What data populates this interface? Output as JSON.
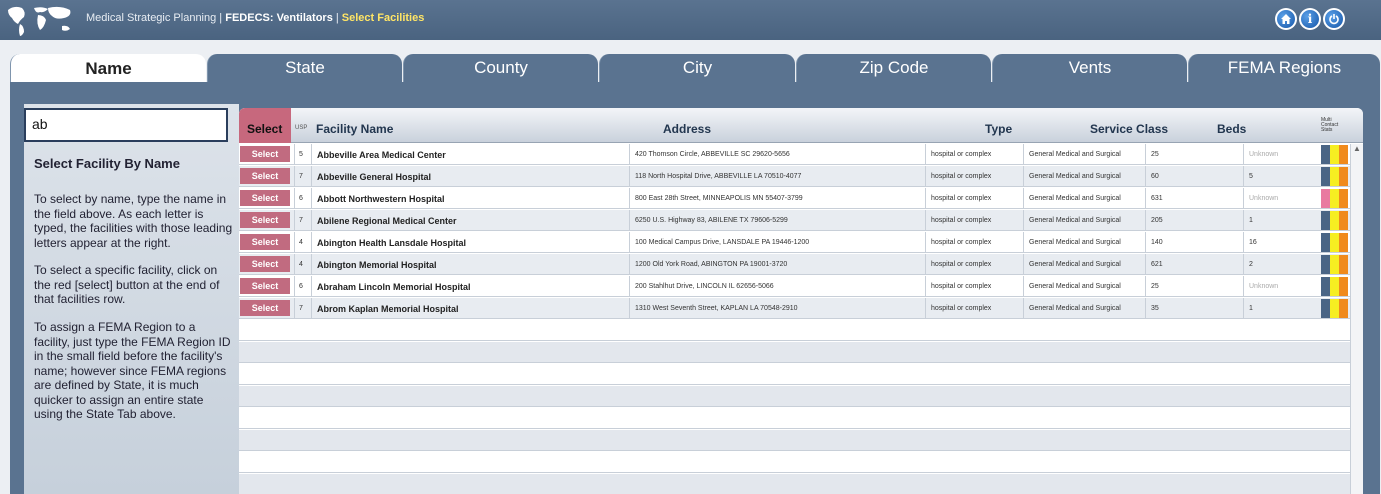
{
  "header": {
    "app": "Medical Strategic Planning",
    "sep": " | ",
    "module": "FEDECS: Ventilators",
    "sep2": " | ",
    "page": "Select Facilities",
    "buttons": [
      "home-icon",
      "info-icon",
      "power-icon"
    ]
  },
  "tabs": [
    "Name",
    "State",
    "County",
    "City",
    "Zip Code",
    "Vents",
    "FEMA Regions"
  ],
  "left": {
    "search_value": "ab",
    "heading": "Select Facility By Name",
    "p1": "To select by name, type the name in the field above. As each letter is typed, the facilities with those leading letters appear at the right.",
    "p2": "To select a specific facility, click on the red [select] button at the end of that facilities row.",
    "p3": "To assign a FEMA Region to a facility, just type the FEMA Region ID in the small field before the facility's name; however since FEMA regions are defined by State, it is much quicker to assign an entire state using the State Tab above."
  },
  "columns": {
    "select": "Select",
    "usp": "USP",
    "name": "Facility Name",
    "address": "Address",
    "type": "Type",
    "service": "Service Class",
    "beds": "Beds",
    "vert": "Multi Contact Stats"
  },
  "select_label": "Select",
  "rows": [
    {
      "usp": "5",
      "name": "Abbeville Area Medical Center",
      "address": "420 Thomson Circle, ABBEVILLE SC 29620-5656",
      "type": "hospital or complex",
      "service": "General Medical and Surgical",
      "beds": "25",
      "vents": "Unknown"
    },
    {
      "usp": "7",
      "name": "Abbeville General Hospital",
      "address": "118 North Hospital Drive, ABBEVILLE LA 70510-4077",
      "type": "hospital or complex",
      "service": "General Medical and Surgical",
      "beds": "60",
      "vents": "5"
    },
    {
      "usp": "6",
      "name": "Abbott Northwestern Hospital",
      "address": "800 East 28th Street, MINNEAPOLIS MN 55407-3799",
      "type": "hospital or complex",
      "service": "General Medical and Surgical",
      "beds": "631",
      "vents": "Unknown"
    },
    {
      "usp": "7",
      "name": "Abilene Regional Medical Center",
      "address": "6250 U.S. Highway 83, ABILENE TX 79606-5299",
      "type": "hospital or complex",
      "service": "General Medical and Surgical",
      "beds": "205",
      "vents": "1"
    },
    {
      "usp": "4",
      "name": "Abington Health Lansdale Hospital",
      "address": "100 Medical Campus Drive, LANSDALE PA 19446-1200",
      "type": "hospital or complex",
      "service": "General Medical and Surgical",
      "beds": "140",
      "vents": "16"
    },
    {
      "usp": "4",
      "name": "Abington Memorial Hospital",
      "address": "1200 Old York Road, ABINGTON PA 19001-3720",
      "type": "hospital or complex",
      "service": "General Medical and Surgical",
      "beds": "621",
      "vents": "2"
    },
    {
      "usp": "6",
      "name": "Abraham Lincoln Memorial Hospital",
      "address": "200 Stahlhut Drive, LINCOLN IL 62656-5066",
      "type": "hospital or complex",
      "service": "General Medical and Surgical",
      "beds": "25",
      "vents": "Unknown"
    },
    {
      "usp": "7",
      "name": "Abrom Kaplan Memorial Hospital",
      "address": "1310 West Seventh Street, KAPLAN LA 70548-2910",
      "type": "hospital or complex",
      "service": "General Medical and Surgical",
      "beds": "35",
      "vents": "1"
    }
  ],
  "stat_colors": {
    "blue": "#4a6585",
    "pink": "#e97aa0",
    "yellow": "#f6ee22",
    "orange": "#f08a1c",
    "accent": "#c16b80"
  },
  "row_first_stat": [
    "blue",
    "blue",
    "pink",
    "blue",
    "blue",
    "blue",
    "blue",
    "blue"
  ]
}
